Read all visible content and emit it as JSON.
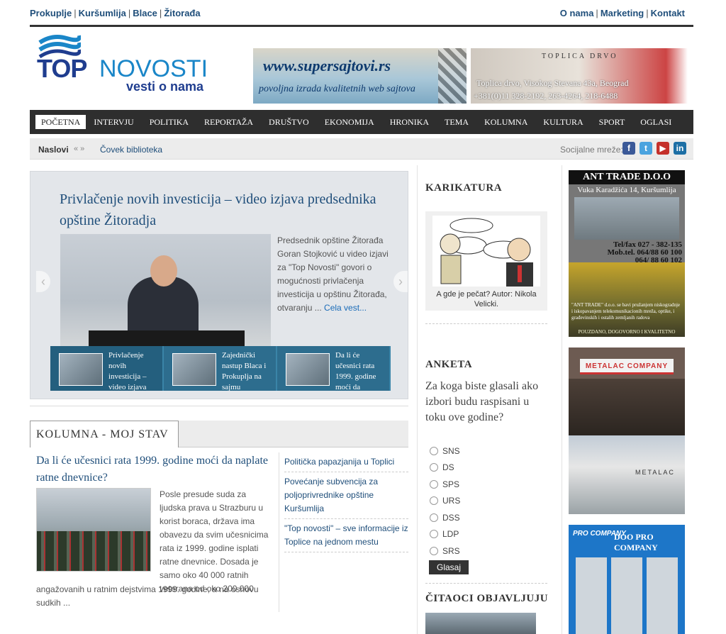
{
  "toplinks": {
    "left": [
      "Prokuplje",
      "Kuršumlija",
      "Blace",
      "Žitorađa"
    ],
    "right": [
      "O nama",
      "Marketing",
      "Kontakt"
    ]
  },
  "logo": {
    "top": "TOP",
    "novosti": "NOVOSTI",
    "tagline": "vesti o nama"
  },
  "banners": {
    "b1_url": "www.supersajtovi.rs",
    "b1_sub": "povoljna izrada kvalitetnih web sajtova",
    "b2_sign": "TOPLICA DRVO",
    "b2_line1": "Toplica drvo, Visokog Stevana 43a, Beograd",
    "b2_line2": "+381(0)11 328-2192, 263-4264, 218-6488"
  },
  "nav": {
    "items": [
      "POČETNA",
      "INTERVJU",
      "POLITIKA",
      "REPORTAŽA",
      "DRUŠTVO",
      "EKONOMIJA",
      "HRONIKA",
      "TEMA",
      "KOLUMNA",
      "KULTURA",
      "SPORT",
      "OGLASI"
    ]
  },
  "headbar": {
    "label": "Naslovi",
    "arrows": "«  »",
    "ticker": "Čovek biblioteka",
    "social": "Socijalne mreže:"
  },
  "slider": {
    "title": "Privlačenje novih investicija – video izjava predsednika opštine Žitoradja",
    "desc": "Predsednik opštine Žitorađa Goran Stojković u video izjavi za \"Top Novosti\" govori o mogućnosti privlačenja investicija u opštinu Žitorađa, otvaranju ...",
    "more": "Cela vest...",
    "thumbs": [
      "Privlačenje novih investicija – video izjava",
      "Zajednički nastup Blaca i Prokuplja na sajmu",
      "Da li će učesnici rata 1999. godine moći da"
    ]
  },
  "column": {
    "tab": "KOLUMNA - MOJ STAV",
    "title": "Da li će učesnici rata 1999. godine moći da naplate ratne dnevnice?",
    "text_right": "Posle presude suda za ljudska prava u Strazburu u korist boraca, država ima obavezu da svim učesnicima rata iz 1999. godine isplati ratne dnevnice. Dosada je samo oko 40 000 ratnih veterana od oko 200 000",
    "text_below": "angažovanih u ratnim dejstvima 1999. godine, a na osnovu sudkih ...",
    "links": [
      "Politička papazjanija u Toplici",
      "Povećanje subvencija za poljoprivrednike opštine Kuršumlija",
      "\"Top novosti\" – sve informacije iz Toplice na jednom mestu"
    ]
  },
  "sidebar": {
    "karikatura_head": "KARIKATURA",
    "cartoon_caption": "A gde je pečat? Autor: Nikola Velicki.",
    "anketa_head": "ANKETA",
    "poll_question": "Za koga biste glasali ako izbori budu raspisani u toku ove godine?",
    "poll_options": [
      "SNS",
      "DS",
      "SPS",
      "URS",
      "DSS",
      "LDP",
      "SRS"
    ],
    "vote_label": "Glasaj",
    "readers_head": "ČITAOCI OBJAVLJUJU"
  },
  "ads": {
    "ad1_head": "ANT TRADE D.O.O",
    "ad1_addr": "Vuka Karadžića 14, Kuršumlija",
    "ad1_tel1": "Tel/fax 027 - 382-135",
    "ad1_tel2": "Mob.tel. 064/88 60 100",
    "ad1_tel3": "064/ 88 60 102",
    "ad1_text": "\"ANT TRADE\" d.o.o. se bavi pružanjem niskogradnje i iskopavanjem telekomunikacionih mreža, optike, i građevinskih i ostalih zemljanih radova",
    "ad1_foot": "POUZDANO, DOGOVORNO I KVALITETNO",
    "ad2_logo": "METALAC COMPANY",
    "ad2_sign": "METALAC",
    "ad3_brand": "PRO COMPANY",
    "ad3_name": "DOO PRO COMPANY"
  }
}
